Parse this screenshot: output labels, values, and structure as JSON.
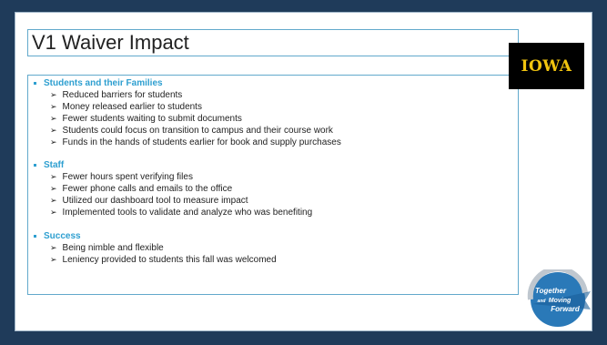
{
  "slide": {
    "title": "V1 Waiver Impact",
    "sections": [
      {
        "heading": "Students and their Families",
        "items": [
          "Reduced barriers for students",
          "Money released earlier to students",
          "Fewer students waiting to submit documents",
          "Students could focus on transition to campus and their course work",
          "Funds in the hands of students earlier for book and supply purchases"
        ]
      },
      {
        "heading": "Staff",
        "items": [
          "Fewer hours spent verifying files",
          "Fewer phone calls and emails to the office",
          "Utilized our dashboard tool to measure impact",
          "Implemented tools to validate and analyze who was benefiting"
        ]
      },
      {
        "heading": "Success",
        "items": [
          "Being nimble and flexible",
          "Leniency provided to students this fall was welcomed"
        ]
      }
    ]
  },
  "logo": {
    "text": "IOWA",
    "background": "#000000",
    "color": "#f1c40f"
  },
  "badge": {
    "line1": "Together",
    "line2": "Moving",
    "line3": "Forward",
    "connector": "and"
  },
  "colors": {
    "background": "#1f3b5a",
    "heading": "#2e9fd0",
    "border": "#62a9cc"
  }
}
